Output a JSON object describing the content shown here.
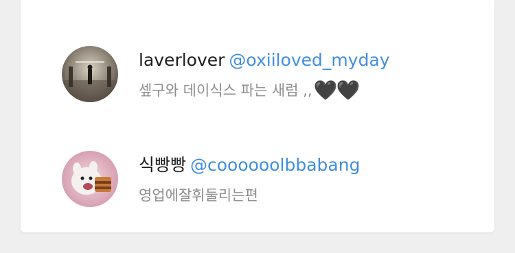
{
  "users": [
    {
      "display_name": "laverlover",
      "handle": "@oxiiloved_myday",
      "bio": "셒구와 데이식스 파는 새럼 ,,",
      "bio_emoji": "🖤🖤"
    },
    {
      "display_name": "식빵빵",
      "handle": "@coooooolbbabang",
      "bio": "영업에잘휘둘리는편",
      "bio_emoji": ""
    }
  ],
  "colors": {
    "handle": "#3f8ee0",
    "name": "#1d1d1d",
    "bio": "#8e8e8e",
    "card": "#ffffff",
    "page": "#efefef"
  }
}
